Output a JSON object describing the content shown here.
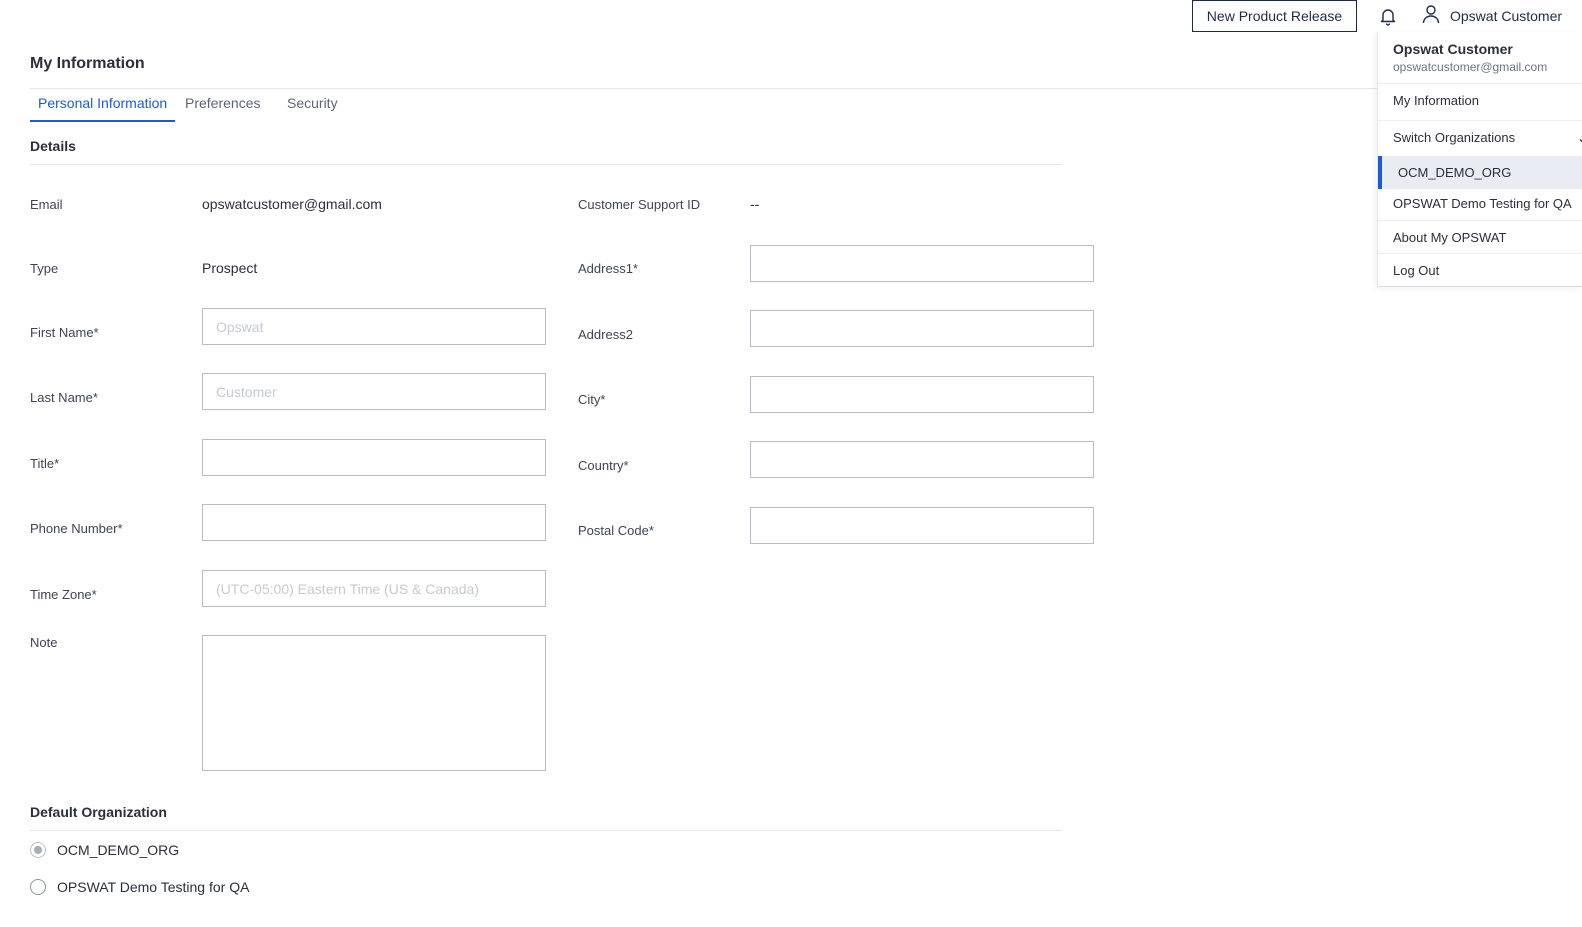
{
  "topbar": {
    "release_button": "New Product Release",
    "user_name": "Opswat Customer"
  },
  "page": {
    "title": "My Information"
  },
  "tabs": [
    {
      "label": "Personal Information",
      "active": true
    },
    {
      "label": "Preferences",
      "active": false
    },
    {
      "label": "Security",
      "active": false
    }
  ],
  "details": {
    "section_title": "Details",
    "email_label": "Email",
    "email_value": "opswatcustomer@gmail.com",
    "type_label": "Type",
    "type_value": "Prospect",
    "first_name_label": "First Name*",
    "first_name_placeholder": "Opswat",
    "last_name_label": "Last Name*",
    "last_name_placeholder": "Customer",
    "title_label": "Title*",
    "phone_label": "Phone Number*",
    "timezone_label": "Time Zone*",
    "timezone_placeholder": "(UTC-05:00) Eastern Time (US & Canada)",
    "note_label": "Note",
    "support_id_label": "Customer Support ID",
    "support_id_value": "--",
    "address1_label": "Address1*",
    "address2_label": "Address2",
    "city_label": "City*",
    "country_label": "Country*",
    "postal_label": "Postal Code*"
  },
  "default_org": {
    "section_title": "Default Organization",
    "options": [
      {
        "label": "OCM_DEMO_ORG",
        "checked": true
      },
      {
        "label": "OPSWAT Demo Testing for QA",
        "checked": false
      }
    ]
  },
  "user_menu": {
    "name": "Opswat Customer",
    "email": "opswatcustomer@gmail.com",
    "items": {
      "my_information": "My Information",
      "switch_orgs": "Switch Organizations",
      "org_selected": "OCM_DEMO_ORG",
      "org_other": "OPSWAT Demo Testing for QA",
      "about": "About My OPSWAT",
      "logout": "Log Out"
    }
  },
  "colors": {
    "accent": "#1d5ad8",
    "text": "#2b2f3a",
    "border": "#b9bdc6"
  }
}
